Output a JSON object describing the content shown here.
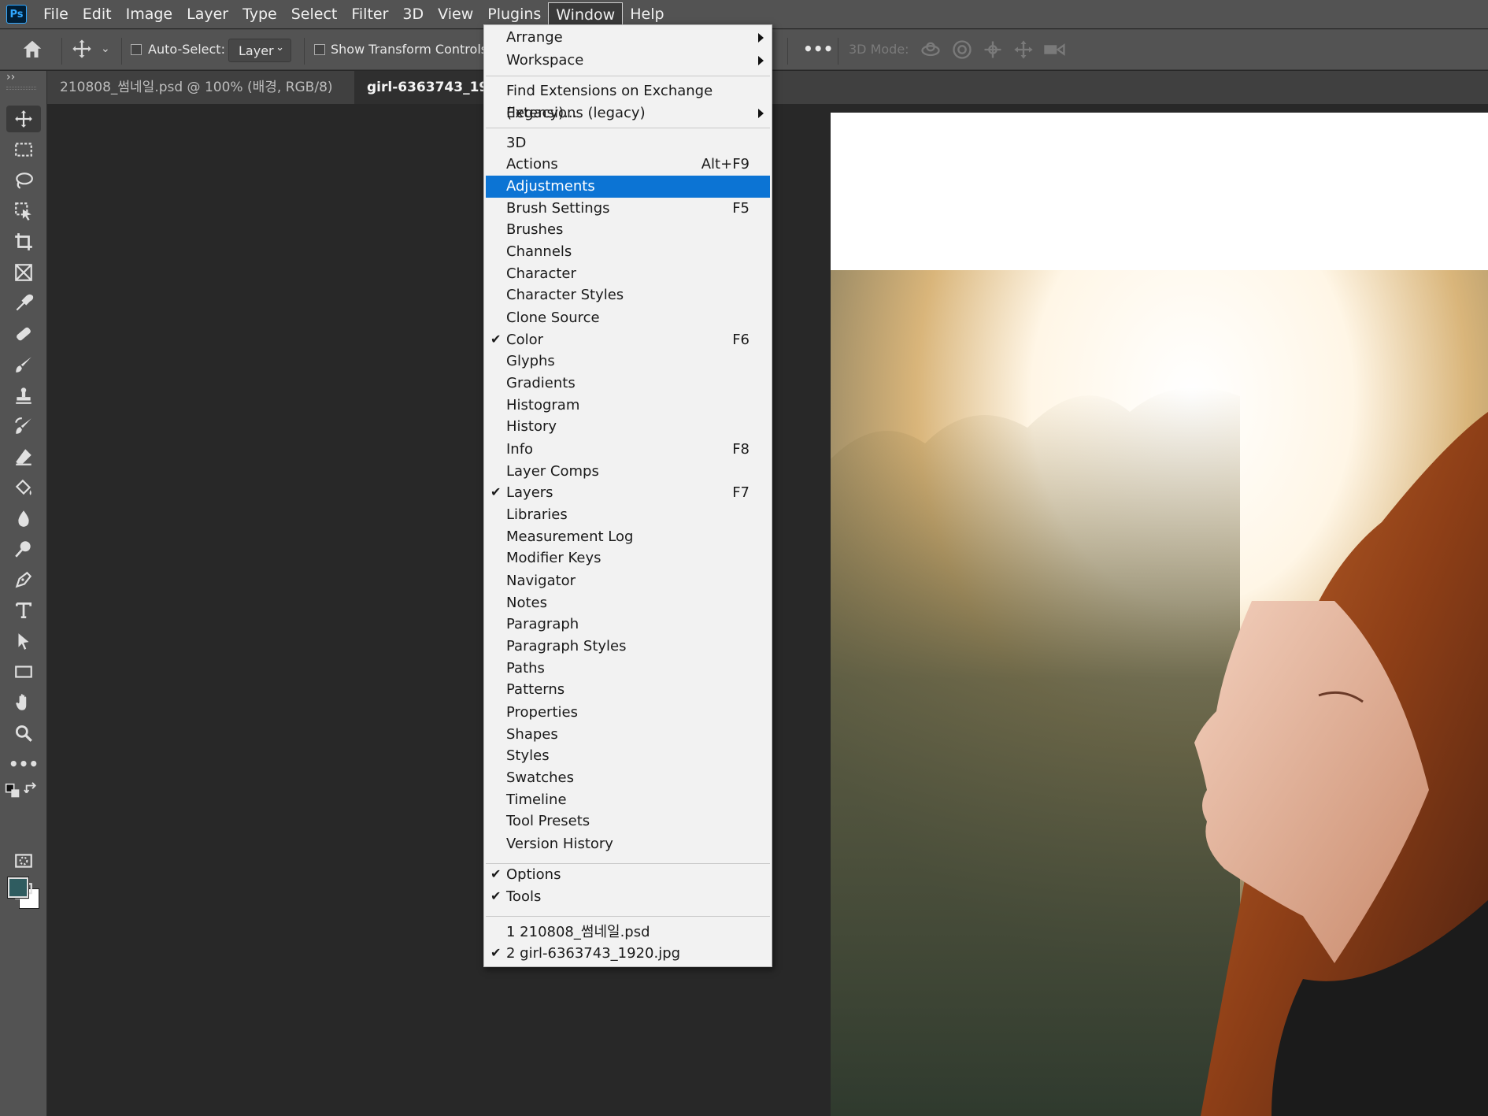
{
  "app": {
    "logo": "Ps"
  },
  "menubar": {
    "items": [
      "File",
      "Edit",
      "Image",
      "Layer",
      "Type",
      "Select",
      "Filter",
      "3D",
      "View",
      "Plugins",
      "Window",
      "Help"
    ],
    "active": "Window"
  },
  "options": {
    "auto_select_label": "Auto-Select:",
    "auto_select_target": "Layer",
    "show_transform_label": "Show Transform Controls",
    "more_label": "•••",
    "mode_3d_label": "3D Mode:",
    "icons": [
      "home-icon",
      "move-tool-icon",
      "orbit-3d-icon",
      "roll-3d-icon",
      "pan-3d-icon",
      "slide-3d-icon",
      "scale-3d-camera-icon"
    ]
  },
  "tabs": [
    {
      "label": "210808_썸네일.psd @ 100% (배경, RGB/8) *",
      "close": "×",
      "active": false
    },
    {
      "label": "girl-6363743_1920.jpg",
      "active": true
    }
  ],
  "toolbar": {
    "collapse_label": "››",
    "tools": [
      "move-tool",
      "rectangular-marquee-tool",
      "lasso-tool",
      "object-selection-tool",
      "crop-tool",
      "frame-tool",
      "eyedropper-tool",
      "spot-healing-brush-tool",
      "brush-tool",
      "clone-stamp-tool",
      "history-brush-tool",
      "eraser-tool",
      "paint-bucket-tool",
      "blur-tool",
      "dodge-tool",
      "pen-tool",
      "type-tool",
      "path-selection-tool",
      "rectangle-tool",
      "hand-tool",
      "zoom-tool",
      "edit-toolbar"
    ],
    "foreground_color": "#2f5c60",
    "background_color": "#ffffff"
  },
  "window_menu": {
    "groups": [
      [
        {
          "label": "Arrange",
          "submenu": true
        },
        {
          "label": "Workspace",
          "submenu": true
        }
      ],
      [
        {
          "label": "Find Extensions on Exchange (legacy)..."
        },
        {
          "label": "Extensions (legacy)",
          "submenu": true
        }
      ],
      [
        {
          "label": "3D"
        },
        {
          "label": "Actions",
          "shortcut": "Alt+F9"
        },
        {
          "label": "Adjustments",
          "highlighted": true
        },
        {
          "label": "Brush Settings",
          "shortcut": "F5"
        },
        {
          "label": "Brushes"
        },
        {
          "label": "Channels"
        },
        {
          "label": "Character"
        },
        {
          "label": "Character Styles"
        },
        {
          "label": "Clone Source"
        },
        {
          "label": "Color",
          "shortcut": "F6",
          "checked": true
        },
        {
          "label": "Glyphs"
        },
        {
          "label": "Gradients"
        },
        {
          "label": "Histogram"
        },
        {
          "label": "History"
        },
        {
          "label": "Info",
          "shortcut": "F8"
        },
        {
          "label": "Layer Comps"
        },
        {
          "label": "Layers",
          "shortcut": "F7",
          "checked": true
        },
        {
          "label": "Libraries"
        },
        {
          "label": "Measurement Log"
        },
        {
          "label": "Modifier Keys"
        },
        {
          "label": "Navigator"
        },
        {
          "label": "Notes"
        },
        {
          "label": "Paragraph"
        },
        {
          "label": "Paragraph Styles"
        },
        {
          "label": "Paths"
        },
        {
          "label": "Patterns"
        },
        {
          "label": "Properties"
        },
        {
          "label": "Shapes"
        },
        {
          "label": "Styles"
        },
        {
          "label": "Swatches"
        },
        {
          "label": "Timeline"
        },
        {
          "label": "Tool Presets"
        },
        {
          "label": "Version History"
        }
      ],
      [
        {
          "label": "Options",
          "checked": true
        },
        {
          "label": "Tools",
          "checked": true
        }
      ],
      [
        {
          "label": "1 210808_썸네일.psd"
        },
        {
          "label": "2 girl-6363743_1920.jpg",
          "checked": true
        }
      ]
    ]
  },
  "colors": {
    "highlight": "#0c74d4",
    "menu_bg": "#f2f2f2",
    "chrome": "#535353",
    "workspace": "#282828"
  }
}
